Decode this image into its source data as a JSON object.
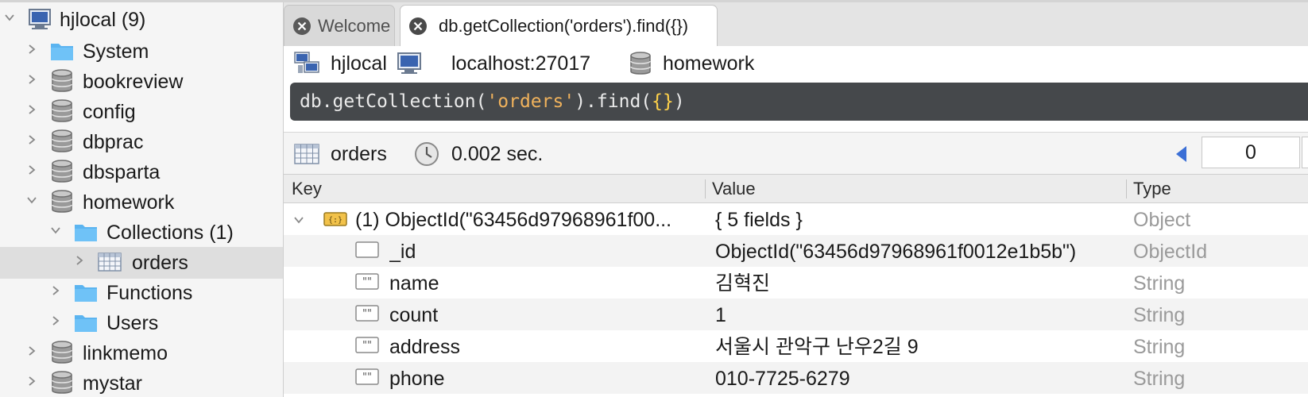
{
  "sidebar": {
    "items": [
      {
        "label": "hjlocal (9)",
        "icon": "server-icon",
        "expanded": true
      },
      {
        "label": "System",
        "icon": "folder-icon",
        "expanded": false
      },
      {
        "label": "bookreview",
        "icon": "database-icon",
        "expanded": false
      },
      {
        "label": "config",
        "icon": "database-icon",
        "expanded": false
      },
      {
        "label": "dbprac",
        "icon": "database-icon",
        "expanded": false
      },
      {
        "label": "dbsparta",
        "icon": "database-icon",
        "expanded": false
      },
      {
        "label": "homework",
        "icon": "database-icon",
        "expanded": true
      },
      {
        "label": "Collections (1)",
        "icon": "folder-icon",
        "expanded": true
      },
      {
        "label": "orders",
        "icon": "collection-table-icon",
        "expanded": false,
        "selected": true
      },
      {
        "label": "Functions",
        "icon": "folder-icon",
        "expanded": false
      },
      {
        "label": "Users",
        "icon": "folder-icon",
        "expanded": false
      },
      {
        "label": "linkmemo",
        "icon": "database-icon",
        "expanded": false
      },
      {
        "label": "mystar",
        "icon": "database-icon",
        "expanded": false
      }
    ]
  },
  "tabs": [
    {
      "label": "Welcome",
      "active": false
    },
    {
      "label": "db.getCollection('orders').find({})",
      "active": true
    }
  ],
  "connection": {
    "connection_name": "hjlocal",
    "host": "localhost:27017",
    "database": "homework"
  },
  "editor": {
    "tokens": [
      {
        "text": "db",
        "kind": "plain"
      },
      {
        "text": ".getCollection(",
        "kind": "plain"
      },
      {
        "text": "'orders'",
        "kind": "str"
      },
      {
        "text": ").find(",
        "kind": "plain"
      },
      {
        "text": "{}",
        "kind": "brace"
      },
      {
        "text": ")",
        "kind": "plain"
      }
    ]
  },
  "result": {
    "collection": "orders",
    "time": "0.002 sec.",
    "page_start": "0"
  },
  "table": {
    "headers": {
      "key": "Key",
      "value": "Value",
      "type": "Type"
    },
    "rows": [
      {
        "key": "(1) ObjectId(\"63456d97968961f00...",
        "value": "{ 5 fields }",
        "type": "Object",
        "icon": "document-icon",
        "expandable": true
      },
      {
        "key": "_id",
        "value": "ObjectId(\"63456d97968961f0012e1b5b\")",
        "type": "ObjectId",
        "icon": "objectid-field-icon"
      },
      {
        "key": "name",
        "value": "김혁진",
        "type": "String",
        "icon": "string-field-icon"
      },
      {
        "key": "count",
        "value": "1",
        "type": "String",
        "icon": "string-field-icon"
      },
      {
        "key": "address",
        "value": "서울시 관악구 난우2길 9",
        "type": "String",
        "icon": "string-field-icon"
      },
      {
        "key": "phone",
        "value": "010-7725-6279",
        "type": "String",
        "icon": "string-field-icon"
      }
    ]
  },
  "colors": {
    "folder": "#5bb4f0",
    "editor_bg": "#45484b",
    "string_literal": "#f0b25c",
    "brace": "#ffd24a",
    "pager_arrow": "#3b6fd6"
  }
}
